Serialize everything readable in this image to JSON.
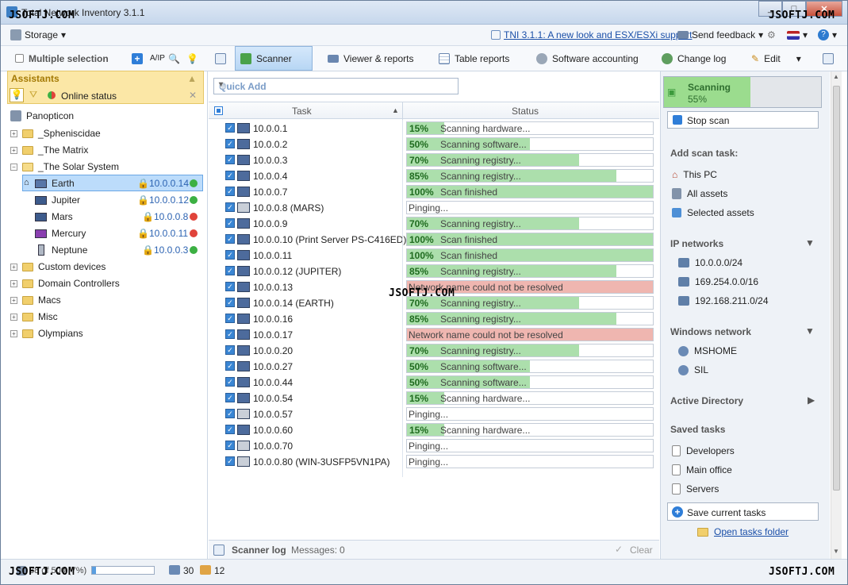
{
  "window": {
    "title": "Total Network Inventory 3.1.1",
    "minimize": "_",
    "maximize": "□",
    "close": "✕"
  },
  "watermark": "JSOFTJ.COM",
  "menubar": {
    "storage": "Storage",
    "news_link": "TNI 3.1.1: A new look and ESX/ESXi support",
    "feedback": "Send feedback"
  },
  "left_toolbar": {
    "multiple_selection": "Multiple selection"
  },
  "tabs": [
    {
      "label": "Scanner",
      "icon": "scanner-icon",
      "active": true
    },
    {
      "label": "Viewer & reports",
      "icon": "viewer-icon"
    },
    {
      "label": "Table reports",
      "icon": "table-icon"
    },
    {
      "label": "Software accounting",
      "icon": "software-icon"
    },
    {
      "label": "Change log",
      "icon": "changelog-icon"
    },
    {
      "label": "Edit",
      "icon": "pencil-icon"
    }
  ],
  "assistants": {
    "title": "Assistants",
    "online_status": "Online status"
  },
  "tree": {
    "root": "Panopticon",
    "groups_top": [
      "_Spheniscidae",
      "_The Matrix"
    ],
    "open_group": "_The Solar System",
    "hosts": [
      {
        "name": "Earth",
        "ip": "10.0.0.14",
        "status": "online"
      },
      {
        "name": "Jupiter",
        "ip": "10.0.0.12",
        "status": "online"
      },
      {
        "name": "Mars",
        "ip": "10.0.0.8",
        "status": "offline"
      },
      {
        "name": "Mercury",
        "ip": "10.0.0.11",
        "status": "offline"
      },
      {
        "name": "Neptune",
        "ip": "10.0.0.3",
        "status": "online"
      }
    ],
    "groups_bottom": [
      "Custom devices",
      "Domain Controllers",
      "Macs",
      "Misc",
      "Olympians"
    ]
  },
  "quick_add": {
    "placeholder": "Quick Add"
  },
  "grid": {
    "col_task": "Task",
    "col_status": "Status"
  },
  "rows": [
    {
      "task": "10.0.0.1",
      "pct": 15,
      "pct_label": "15%",
      "text": "Scanning hardware...",
      "state": "progress"
    },
    {
      "task": "10.0.0.2",
      "pct": 50,
      "pct_label": "50%",
      "text": "Scanning software...",
      "state": "progress"
    },
    {
      "task": "10.0.0.3",
      "pct": 70,
      "pct_label": "70%",
      "text": "Scanning registry...",
      "state": "progress"
    },
    {
      "task": "10.0.0.4",
      "pct": 85,
      "pct_label": "85%",
      "text": "Scanning registry...",
      "state": "progress"
    },
    {
      "task": "10.0.0.7",
      "pct": 100,
      "pct_label": "100%",
      "text": "Scan finished",
      "state": "progress"
    },
    {
      "task": "10.0.0.8 (MARS)",
      "pct": 0,
      "pct_label": "",
      "text": "Pinging...",
      "state": "ping"
    },
    {
      "task": "10.0.0.9",
      "pct": 70,
      "pct_label": "70%",
      "text": "Scanning registry...",
      "state": "progress"
    },
    {
      "task": "10.0.0.10 (Print Server PS-C416ED)",
      "pct": 100,
      "pct_label": "100%",
      "text": "Scan finished",
      "state": "progress"
    },
    {
      "task": "10.0.0.11",
      "pct": 100,
      "pct_label": "100%",
      "text": "Scan finished",
      "state": "progress"
    },
    {
      "task": "10.0.0.12 (JUPITER)",
      "pct": 85,
      "pct_label": "85%",
      "text": "Scanning registry...",
      "state": "progress"
    },
    {
      "task": "10.0.0.13",
      "pct": 100,
      "pct_label": "",
      "text": "Network name could not be resolved",
      "state": "error"
    },
    {
      "task": "10.0.0.14 (EARTH)",
      "pct": 70,
      "pct_label": "70%",
      "text": "Scanning registry...",
      "state": "progress"
    },
    {
      "task": "10.0.0.16",
      "pct": 85,
      "pct_label": "85%",
      "text": "Scanning registry...",
      "state": "progress"
    },
    {
      "task": "10.0.0.17",
      "pct": 100,
      "pct_label": "",
      "text": "Network name could not be resolved",
      "state": "error"
    },
    {
      "task": "10.0.0.20",
      "pct": 70,
      "pct_label": "70%",
      "text": "Scanning registry...",
      "state": "progress"
    },
    {
      "task": "10.0.0.27",
      "pct": 50,
      "pct_label": "50%",
      "text": "Scanning software...",
      "state": "progress"
    },
    {
      "task": "10.0.0.44",
      "pct": 50,
      "pct_label": "50%",
      "text": "Scanning software...",
      "state": "progress"
    },
    {
      "task": "10.0.0.54",
      "pct": 15,
      "pct_label": "15%",
      "text": "Scanning hardware...",
      "state": "progress"
    },
    {
      "task": "10.0.0.57",
      "pct": 0,
      "pct_label": "",
      "text": "Pinging...",
      "state": "ping"
    },
    {
      "task": "10.0.0.60",
      "pct": 15,
      "pct_label": "15%",
      "text": "Scanning hardware...",
      "state": "progress"
    },
    {
      "task": "10.0.0.70",
      "pct": 0,
      "pct_label": "",
      "text": "Pinging...",
      "state": "ping"
    },
    {
      "task": "10.0.0.80 (WIN-3USFP5VN1PA)",
      "pct": 0,
      "pct_label": "",
      "text": "Pinging...",
      "state": "ping"
    }
  ],
  "log": {
    "title": "Scanner log",
    "messages_label": "Messages:",
    "messages_count": "0",
    "clear": "Clear"
  },
  "right": {
    "scanning": "Scanning",
    "scanning_pct": "55%",
    "scanning_value": 55,
    "stop_scan": "Stop scan",
    "add_scan_task": "Add scan task:",
    "scan_targets": [
      "This PC",
      "All assets",
      "Selected assets"
    ],
    "ip_networks_title": "IP networks",
    "ip_networks": [
      "10.0.0.0/24",
      "169.254.0.0/16",
      "192.168.211.0/24"
    ],
    "windows_network_title": "Windows network",
    "windows_network": [
      "MSHOME",
      "SIL"
    ],
    "active_directory": "Active Directory",
    "saved_tasks_title": "Saved tasks",
    "saved_tasks": [
      "Developers",
      "Main office",
      "Servers"
    ],
    "save_current": "Save current tasks",
    "open_folder": "Open tasks folder"
  },
  "statusbar": {
    "progress_text": "38 of 500 (7%)",
    "progress_value": 7,
    "count_a": "30",
    "count_b": "12"
  }
}
